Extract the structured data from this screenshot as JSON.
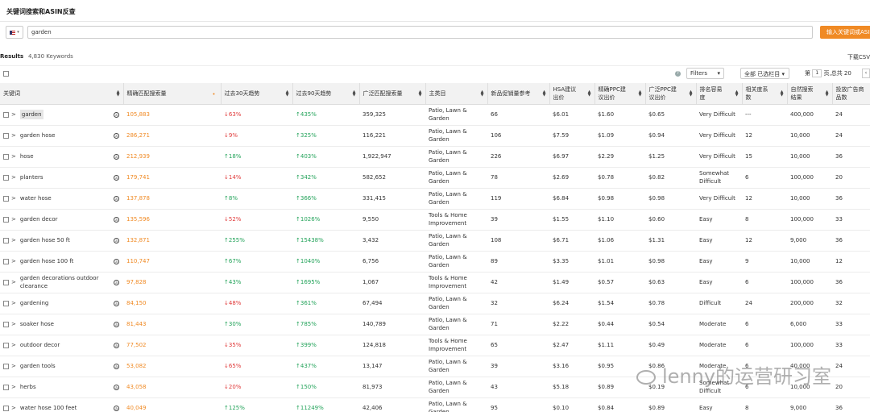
{
  "page": {
    "title": "关键词搜索和ASIN反查",
    "search": {
      "flag_label": "▾",
      "value": "garden",
      "button": "输入关键词或ASIN"
    },
    "results_label": "Results",
    "results_count": "4,830 Keywords",
    "download_csv": "下载CSV",
    "toolbar": {
      "help": "?",
      "filters": "Filters",
      "filters_caret": "▾",
      "columns": "全部 已选栏目",
      "columns_caret": "▾",
      "page_prefix": "第",
      "page_value": "1",
      "page_suffix": "页,总共 20",
      "prev": "‹"
    }
  },
  "table": {
    "headers": [
      "关键词",
      "精确匹配搜索量",
      "过去30天趋势",
      "过去90天趋势",
      "广泛匹配搜索量",
      "主类目",
      "新品促销量参考",
      "HSA建议出价",
      "精确PPC建议出价",
      "广泛PPC建议出价",
      "排名容易度",
      "相关度系数",
      "自然搜索结果",
      "投放广告商品数"
    ],
    "rows": [
      {
        "kw": "garden",
        "vol": "105,883",
        "t30": "↓63%",
        "t30dir": "down",
        "t90": "↑435%",
        "t90dir": "up",
        "broad": "359,325",
        "cat": "Patio, Lawn & Garden",
        "promo": "66",
        "hsa": "$6.01",
        "exact": "$1.60",
        "wide": "$0.65",
        "rank": "Very Difficult",
        "rel": "---",
        "organic": "400,000",
        "ads": "24"
      },
      {
        "kw": "garden hose",
        "vol": "286,271",
        "t30": "↓9%",
        "t30dir": "down",
        "t90": "↑325%",
        "t90dir": "up",
        "broad": "116,221",
        "cat": "Patio, Lawn & Garden",
        "promo": "106",
        "hsa": "$7.59",
        "exact": "$1.09",
        "wide": "$0.94",
        "rank": "Very Difficult",
        "rel": "12",
        "organic": "10,000",
        "ads": "24"
      },
      {
        "kw": "hose",
        "vol": "212,939",
        "t30": "↑18%",
        "t30dir": "up",
        "t90": "↑403%",
        "t90dir": "up",
        "broad": "1,922,947",
        "cat": "Patio, Lawn & Garden",
        "promo": "226",
        "hsa": "$6.97",
        "exact": "$2.29",
        "wide": "$1.25",
        "rank": "Very Difficult",
        "rel": "15",
        "organic": "10,000",
        "ads": "36"
      },
      {
        "kw": "planters",
        "vol": "179,741",
        "t30": "↓14%",
        "t30dir": "down",
        "t90": "↑342%",
        "t90dir": "up",
        "broad": "582,652",
        "cat": "Patio, Lawn & Garden",
        "promo": "78",
        "hsa": "$2.69",
        "exact": "$0.78",
        "wide": "$0.82",
        "rank": "Somewhat Difficult",
        "rel": "6",
        "organic": "100,000",
        "ads": "20"
      },
      {
        "kw": "water hose",
        "vol": "137,878",
        "t30": "↑8%",
        "t30dir": "up",
        "t90": "↑366%",
        "t90dir": "up",
        "broad": "331,415",
        "cat": "Patio, Lawn & Garden",
        "promo": "119",
        "hsa": "$6.84",
        "exact": "$0.98",
        "wide": "$0.98",
        "rank": "Very Difficult",
        "rel": "12",
        "organic": "10,000",
        "ads": "36"
      },
      {
        "kw": "garden decor",
        "vol": "135,596",
        "t30": "↓52%",
        "t30dir": "down",
        "t90": "↑1026%",
        "t90dir": "up",
        "broad": "9,550",
        "cat": "Tools & Home Improvement",
        "promo": "39",
        "hsa": "$1.55",
        "exact": "$1.10",
        "wide": "$0.60",
        "rank": "Easy",
        "rel": "8",
        "organic": "100,000",
        "ads": "33"
      },
      {
        "kw": "garden hose 50 ft",
        "vol": "132,871",
        "t30": "↑255%",
        "t30dir": "up",
        "t90": "↑15438%",
        "t90dir": "up",
        "broad": "3,432",
        "cat": "Patio, Lawn & Garden",
        "promo": "108",
        "hsa": "$6.71",
        "exact": "$1.06",
        "wide": "$1.31",
        "rank": "Easy",
        "rel": "12",
        "organic": "9,000",
        "ads": "36"
      },
      {
        "kw": "garden hose 100 ft",
        "vol": "110,747",
        "t30": "↑67%",
        "t30dir": "up",
        "t90": "↑1040%",
        "t90dir": "up",
        "broad": "6,756",
        "cat": "Patio, Lawn & Garden",
        "promo": "89",
        "hsa": "$3.35",
        "exact": "$1.01",
        "wide": "$0.98",
        "rank": "Easy",
        "rel": "9",
        "organic": "10,000",
        "ads": "12"
      },
      {
        "kw": "garden decorations outdoor clearance",
        "vol": "97,828",
        "t30": "↑43%",
        "t30dir": "up",
        "t90": "↑1695%",
        "t90dir": "up",
        "broad": "1,067",
        "cat": "Tools & Home Improvement",
        "promo": "42",
        "hsa": "$1.49",
        "exact": "$0.57",
        "wide": "$0.63",
        "rank": "Easy",
        "rel": "6",
        "organic": "100,000",
        "ads": "36"
      },
      {
        "kw": "gardening",
        "vol": "84,150",
        "t30": "↓48%",
        "t30dir": "down",
        "t90": "↑361%",
        "t90dir": "up",
        "broad": "67,494",
        "cat": "Patio, Lawn & Garden",
        "promo": "32",
        "hsa": "$6.24",
        "exact": "$1.54",
        "wide": "$0.78",
        "rank": "Difficult",
        "rel": "24",
        "organic": "200,000",
        "ads": "32"
      },
      {
        "kw": "soaker hose",
        "vol": "81,443",
        "t30": "↑30%",
        "t30dir": "up",
        "t90": "↑785%",
        "t90dir": "up",
        "broad": "140,789",
        "cat": "Patio, Lawn & Garden",
        "promo": "71",
        "hsa": "$2.22",
        "exact": "$0.44",
        "wide": "$0.54",
        "rank": "Moderate",
        "rel": "6",
        "organic": "6,000",
        "ads": "33"
      },
      {
        "kw": "outdoor decor",
        "vol": "77,502",
        "t30": "↓35%",
        "t30dir": "down",
        "t90": "↑399%",
        "t90dir": "up",
        "broad": "124,818",
        "cat": "Tools & Home Improvement",
        "promo": "65",
        "hsa": "$2.47",
        "exact": "$1.11",
        "wide": "$0.49",
        "rank": "Moderate",
        "rel": "6",
        "organic": "100,000",
        "ads": "33"
      },
      {
        "kw": "garden tools",
        "vol": "53,082",
        "t30": "↓65%",
        "t30dir": "down",
        "t90": "↑437%",
        "t90dir": "up",
        "broad": "13,147",
        "cat": "Patio, Lawn & Garden",
        "promo": "39",
        "hsa": "$3.16",
        "exact": "$0.95",
        "wide": "$0.86",
        "rank": "Moderate",
        "rel": "6",
        "organic": "40,000",
        "ads": "24"
      },
      {
        "kw": "herbs",
        "vol": "43,058",
        "t30": "↓20%",
        "t30dir": "down",
        "t90": "↑150%",
        "t90dir": "up",
        "broad": "81,973",
        "cat": "Patio, Lawn & Garden",
        "promo": "43",
        "hsa": "$5.18",
        "exact": "$0.89",
        "wide": "$0.19",
        "rank": "Somewhat Difficult",
        "rel": "6",
        "organic": "10,000",
        "ads": "20"
      },
      {
        "kw": "water hose 100 feet",
        "vol": "40,049",
        "t30": "↑125%",
        "t30dir": "up",
        "t90": "↑11249%",
        "t90dir": "up",
        "broad": "42,406",
        "cat": "Patio, Lawn & Garden",
        "promo": "95",
        "hsa": "$0.10",
        "exact": "$0.84",
        "wide": "$0.89",
        "rank": "Easy",
        "rel": "8",
        "organic": "9,000",
        "ads": "36"
      }
    ]
  },
  "watermark": "lenny的运营研习室",
  "colors": {
    "accent": "#f08a24",
    "up": "#23a35a",
    "down": "#e03a3a"
  }
}
